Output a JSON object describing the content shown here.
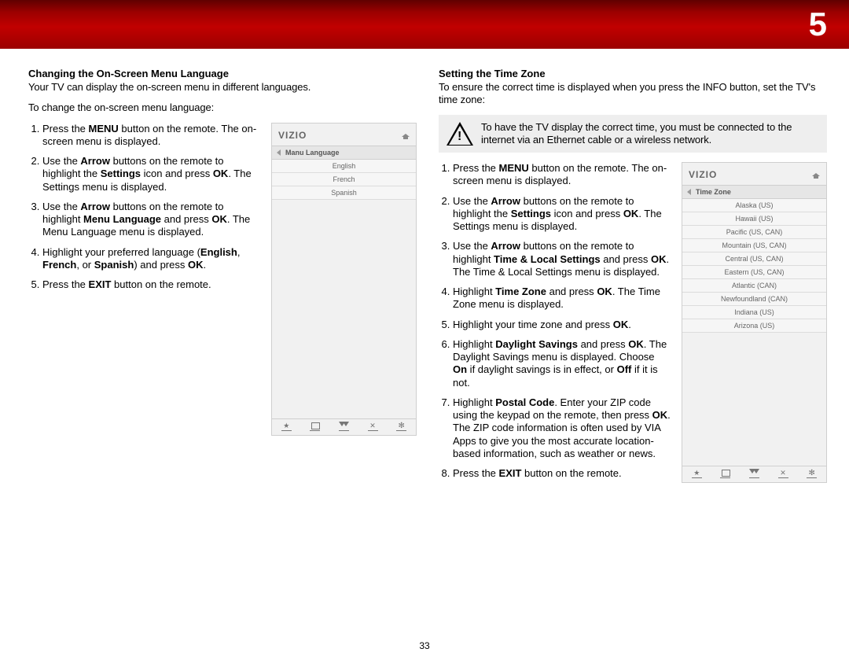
{
  "chapter_number": "5",
  "page_number": "33",
  "left": {
    "heading": "Changing the On-Screen Menu Language",
    "intro1": "Your TV can display the on-screen menu in different languages.",
    "intro2": "To change the on-screen menu language:",
    "steps_html": [
      "Press the <strong>MENU</strong> button on the remote. The on-screen menu is displayed.",
      "Use the <strong>Arrow</strong> buttons on the remote to highlight the <strong>Settings</strong> icon and press <strong>OK</strong>. The Settings menu is displayed.",
      "Use the <strong>Arrow</strong> buttons on the remote to highlight <strong>Menu Language</strong> and press <strong>OK</strong>. The Menu Language menu is displayed.",
      "Highlight your preferred language (<strong>English</strong>, <strong>French</strong>, or <strong>Spanish</strong>) and press <strong>OK</strong>.",
      "Press the <strong>EXIT</strong> button on the remote."
    ],
    "tv": {
      "logo": "VIZIO",
      "title": "Manu Language",
      "items": [
        "English",
        "French",
        "Spanish"
      ]
    }
  },
  "right": {
    "heading": "Setting the Time Zone",
    "intro": "To ensure the correct time is displayed when you press the INFO button, set the TV's time zone:",
    "warning": "To have the TV display the correct time, you must be connected to the internet via an Ethernet cable or a wireless network.",
    "steps_html": [
      "Press the <strong>MENU</strong> button on the remote. The on-screen menu is displayed.",
      "Use the <strong>Arrow</strong> buttons on the remote to highlight the <strong>Settings</strong> icon and press <strong>OK</strong>. The Settings menu is displayed.",
      "Use the <strong>Arrow</strong> buttons on the remote to highlight <strong>Time & Local Settings</strong> and press <strong>OK</strong>. The Time & Local Settings menu is displayed.",
      "Highlight <strong>Time Zone</strong> and press <strong>OK</strong>. The Time Zone menu is displayed.",
      "Highlight your time zone and press <strong>OK</strong>.",
      "Highlight <strong>Daylight Savings</strong> and press <strong>OK</strong>. The Daylight Savings menu is displayed. Choose <strong>On</strong> if daylight savings is in effect, or <strong>Off</strong> if it is not.",
      "Highlight <strong>Postal Code</strong>. Enter your ZIP code using the keypad on the remote, then press <strong>OK</strong>. The ZIP code information is often used by VIA Apps to give you the most accurate location-based information, such as weather or news.",
      "Press the <strong>EXIT</strong> button on the remote."
    ],
    "tv": {
      "logo": "VIZIO",
      "title": "Time Zone",
      "items": [
        "Alaska (US)",
        "Hawaii (US)",
        "Pacific (US, CAN)",
        "Mountain (US, CAN)",
        "Central (US, CAN)",
        "Eastern (US, CAN)",
        "Atlantic (CAN)",
        "Newfoundland (CAN)",
        "Indiana (US)",
        "Arizona (US)"
      ]
    }
  }
}
